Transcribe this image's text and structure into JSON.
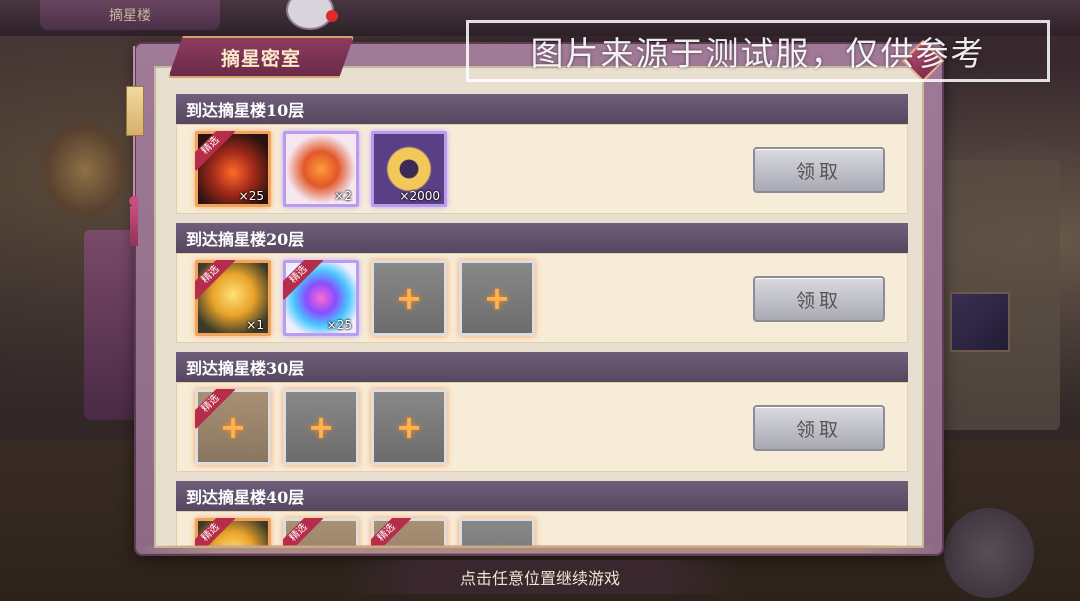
{
  "background": {
    "top_tab_label": "摘星楼"
  },
  "watermark": "图片来源于测试服，仅供参考",
  "dialog": {
    "title": "摘星密室",
    "claim_label": "领取",
    "ribbon_label": "精选",
    "rows": [
      {
        "header": "到达摘星楼10层",
        "slots": [
          {
            "icon": "fire-scroll-icon",
            "count": "×25",
            "featured": true,
            "empty": false
          },
          {
            "icon": "crystal-scroll-icon",
            "count": "×2",
            "featured": false,
            "empty": false
          },
          {
            "icon": "gold-ring-icon",
            "count": "×2000",
            "featured": false,
            "empty": false
          }
        ]
      },
      {
        "header": "到达摘星楼20层",
        "slots": [
          {
            "icon": "golden-lotus-icon",
            "count": "×1",
            "featured": true,
            "empty": false
          },
          {
            "icon": "crystal-flame-icon",
            "count": "×25",
            "featured": true,
            "empty": false
          },
          {
            "empty": true
          },
          {
            "empty": true
          }
        ]
      },
      {
        "header": "到达摘星楼30层",
        "slots": [
          {
            "empty": true,
            "featured": true
          },
          {
            "empty": true
          },
          {
            "empty": true
          }
        ]
      },
      {
        "header": "到达摘星楼40层",
        "slots": [
          {
            "empty": false,
            "featured": true,
            "icon": "golden-lotus-icon"
          },
          {
            "empty": true,
            "featured": true
          },
          {
            "empty": true,
            "featured": true
          },
          {
            "empty": true
          }
        ]
      }
    ]
  },
  "hint": "点击任意位置继续游戏"
}
